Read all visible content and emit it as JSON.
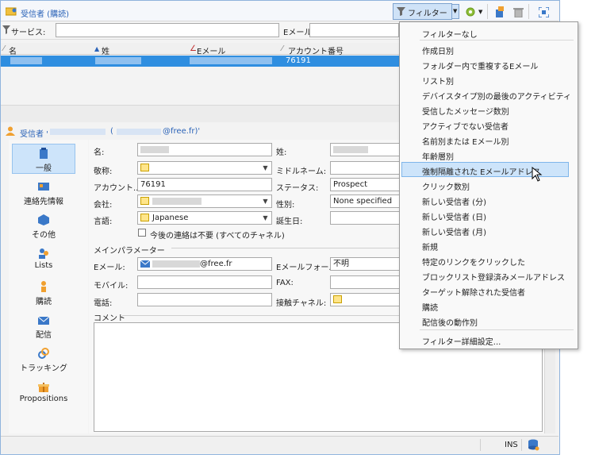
{
  "window": {
    "title": "受信者 (購読)"
  },
  "toolbar": {
    "filter_label": "フィルター"
  },
  "filters": {
    "service_label": "サービス:",
    "email_label": "Eメール"
  },
  "list": {
    "columns": [
      "名",
      "姓",
      "Eメール",
      "アカウント番号"
    ],
    "row": {
      "account": "76191"
    }
  },
  "detail": {
    "header_prefix": "受信者 '",
    "header_mid": "(",
    "header_suffix": "@free.fr)'"
  },
  "nav": {
    "items": [
      {
        "label": "一般"
      },
      {
        "label": "連絡先情報"
      },
      {
        "label": "その他"
      },
      {
        "label": "Lists"
      },
      {
        "label": "購読"
      },
      {
        "label": "配信"
      },
      {
        "label": "トラッキング"
      },
      {
        "label": "Propositions"
      }
    ]
  },
  "form": {
    "first_name_label": "名:",
    "last_name_label": "姓:",
    "salutation_label": "敬称:",
    "middle_name_label": "ミドルネーム:",
    "account_label": "アカウント...:",
    "account_value": "76191",
    "status_label": "ステータス:",
    "status_value": "Prospect",
    "company_label": "会社:",
    "gender_label": "性別:",
    "gender_value": "None specified",
    "language_label": "言語:",
    "language_value": "Japanese",
    "birthday_label": "誕生日:",
    "no_contact_label": "今後の連絡は不要 (すべてのチャネル)",
    "params_section": "メインパラメーター",
    "email_label": "Eメール:",
    "email_value": "@free.fr",
    "email_format_label": "Eメールフォー...:",
    "email_format_value": "不明",
    "mobile_label": "モバイル:",
    "fax_label": "FAX:",
    "phone_label": "電話:",
    "channel_label": "接触チャネル:",
    "comment_label": "コメント"
  },
  "statusbar": {
    "ins": "INS"
  },
  "filter_menu": {
    "items": [
      "フィルターなし",
      "作成日別",
      "フォルダー内で重複するEメール",
      "リスト別",
      "デバイスタイプ別の最後のアクティビティ",
      "受信したメッセージ数別",
      "アクティブでない受信者",
      "名前別または Eメール別",
      "年齢層別",
      "強制隔離された Eメールアドレス",
      "クリック数別",
      "新しい受信者 (分)",
      "新しい受信者 (日)",
      "新しい受信者 (月)",
      "新規",
      "特定のリンクをクリックした",
      "ブロックリスト登録済みメールアドレス",
      "ターゲット解除された受信者",
      "購読",
      "配信後の動作別",
      "フィルター詳細設定..."
    ]
  },
  "colors": {
    "accent": "#2f8ee0",
    "title": "#2b63b8",
    "highlight": "#cde4fa"
  }
}
